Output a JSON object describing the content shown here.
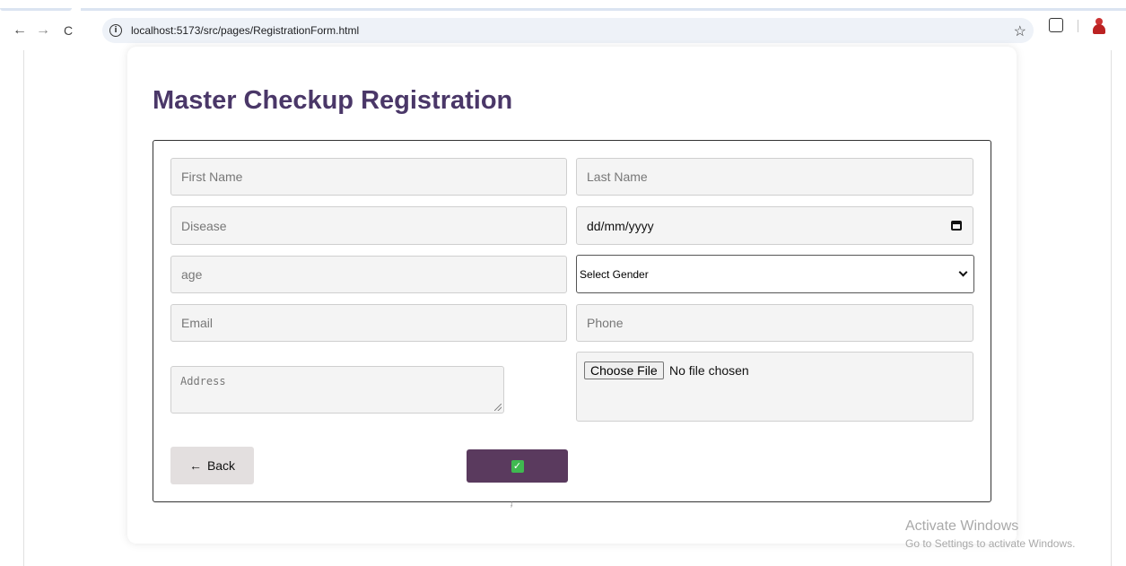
{
  "browser": {
    "url": "localhost:5173/src/pages/RegistrationForm.html",
    "icons": [
      "back-arrow-icon",
      "forward-arrow-icon",
      "reload-icon",
      "site-info-icon",
      "bookmark-star-icon",
      "extensions-icon",
      "profile-icon"
    ],
    "glyphs": {
      "back": "←",
      "forward": "→",
      "reload": "C",
      "info": "i",
      "star": "☆"
    }
  },
  "form": {
    "title": "Master Checkup Registration",
    "first_name_placeholder": "First Name",
    "last_name_placeholder": "Last Name",
    "disease_placeholder": "Disease",
    "date_value": "dd/mm/yyyy",
    "age_placeholder": "age",
    "gender_selected": "Select Gender",
    "email_placeholder": "Email",
    "phone_placeholder": "Phone",
    "address_placeholder": "Address",
    "file_button_label": "Choose File",
    "file_status": "No file chosen",
    "back_arrow": "←",
    "back_label": "Back",
    "submit_icon_glyph": "✓",
    "tiny_mark": "ɟ"
  },
  "colors": {
    "title": "#4a3768",
    "submit_button": "#5a3a5e",
    "check_icon": "#3fb950",
    "back_button": "#e3dfdf"
  },
  "watermark": {
    "title": "Activate Windows",
    "subtitle": "Go to Settings to activate Windows."
  }
}
